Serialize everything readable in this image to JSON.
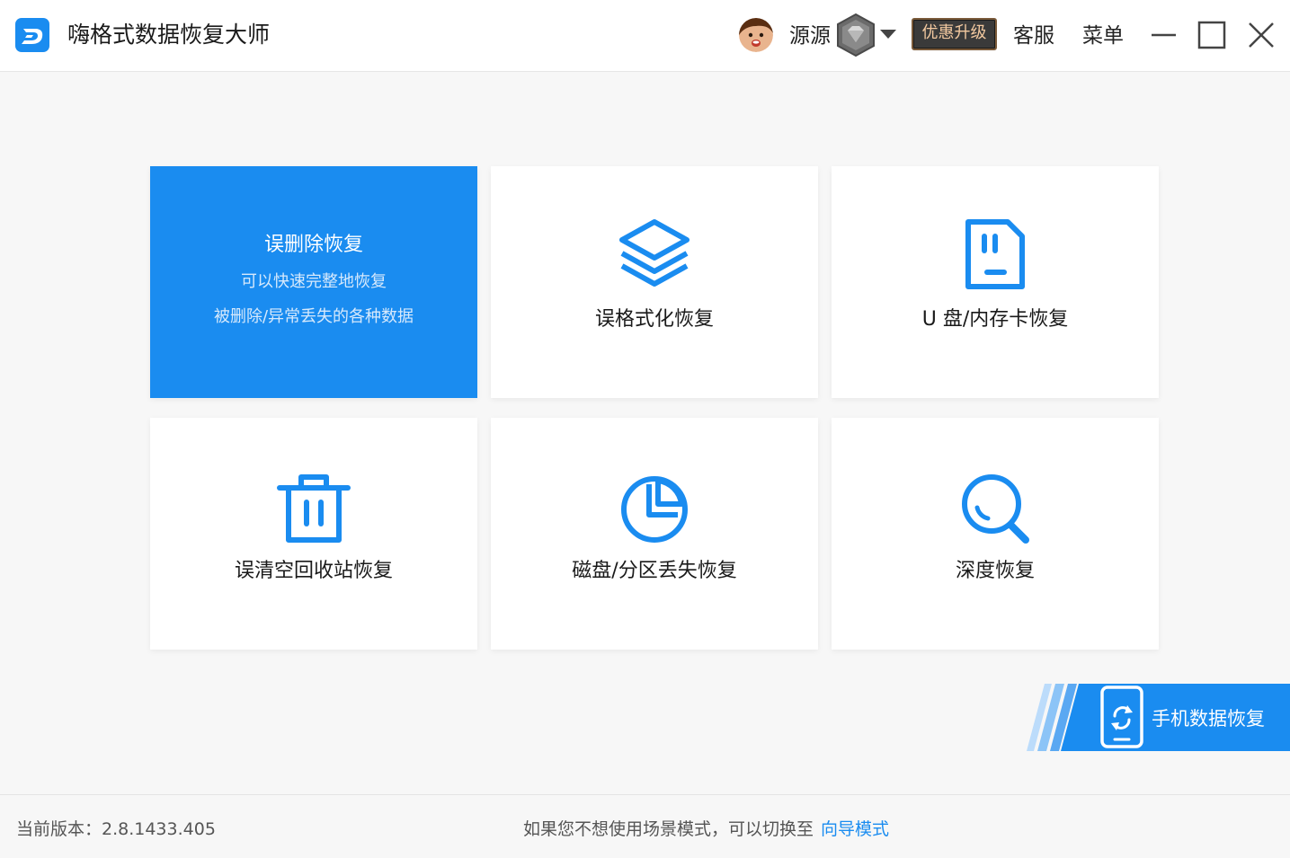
{
  "app": {
    "title": "嗨格式数据恢复大师"
  },
  "header": {
    "username": "源源",
    "upgrade_label": "优惠升级",
    "service_label": "客服",
    "menu_label": "菜单"
  },
  "cards": [
    {
      "title": "误删除恢复",
      "desc1": "可以快速完整地恢复",
      "desc2": "被删除/异常丢失的各种数据",
      "icon": "trash-icon"
    },
    {
      "title": "误格式化恢复",
      "icon": "layers-icon"
    },
    {
      "title": "U 盘/内存卡恢复",
      "icon": "sd-card-icon"
    },
    {
      "title": "误清空回收站恢复",
      "icon": "trash-icon"
    },
    {
      "title": "磁盘/分区丢失恢复",
      "icon": "pie-chart-icon"
    },
    {
      "title": "深度恢复",
      "icon": "search-icon"
    }
  ],
  "mobile": {
    "label": "手机数据恢复",
    "icon": "phone-sync-icon"
  },
  "footer": {
    "version": "当前版本：2.8.1433.405",
    "hint": "如果您不想使用场景模式，可以切换至",
    "guide_link": "向导模式"
  },
  "colors": {
    "accent": "#1a8cf0",
    "background": "#f7f7f7"
  }
}
